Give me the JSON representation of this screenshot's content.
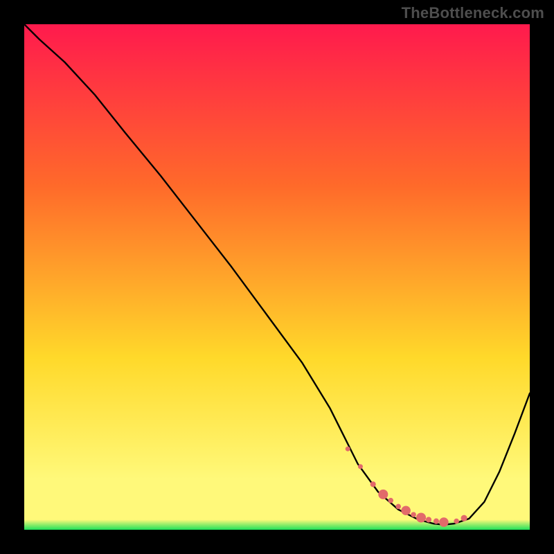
{
  "watermark": "TheBottleneck.com",
  "colors": {
    "gradient_top": "#ff1a4d",
    "gradient_mid1": "#ff6a2a",
    "gradient_mid2": "#ffd92a",
    "gradient_mid3": "#fff97a",
    "gradient_bottom": "#1fe05a",
    "curve": "#000000",
    "marker": "#e26a6a"
  },
  "chart_data": {
    "type": "line",
    "title": "",
    "xlabel": "",
    "ylabel": "",
    "xlim": [
      0,
      100
    ],
    "ylim": [
      0,
      100
    ],
    "grid": false,
    "legend": false,
    "series": [
      {
        "name": "bottleneck-curve",
        "x": [
          0,
          3,
          8,
          14,
          20,
          27,
          34,
          41,
          48,
          55,
          60.5,
          63,
          66,
          70,
          74,
          78,
          81,
          83,
          85,
          88,
          91,
          94,
          97,
          100
        ],
        "y": [
          100,
          97,
          92.5,
          86,
          78.5,
          70,
          61,
          52,
          42.5,
          33,
          24,
          19,
          13,
          7.5,
          4,
          2,
          1.2,
          1,
          1.2,
          2.2,
          5.5,
          11.5,
          19,
          27
        ]
      }
    ],
    "markers": {
      "name": "trough-markers",
      "x": [
        64,
        66.5,
        69,
        71,
        72.5,
        74,
        75.5,
        77,
        78.5,
        80,
        81.5,
        83,
        85.5,
        87
      ],
      "y": [
        16,
        12.5,
        9,
        7,
        5.8,
        4.6,
        3.8,
        3.0,
        2.4,
        2.0,
        1.7,
        1.5,
        1.7,
        2.3
      ],
      "size": [
        2.6,
        2.6,
        3.0,
        5.2,
        2.8,
        2.8,
        5.0,
        2.8,
        5.2,
        3.0,
        3.0,
        5.0,
        2.8,
        3.4
      ]
    }
  }
}
